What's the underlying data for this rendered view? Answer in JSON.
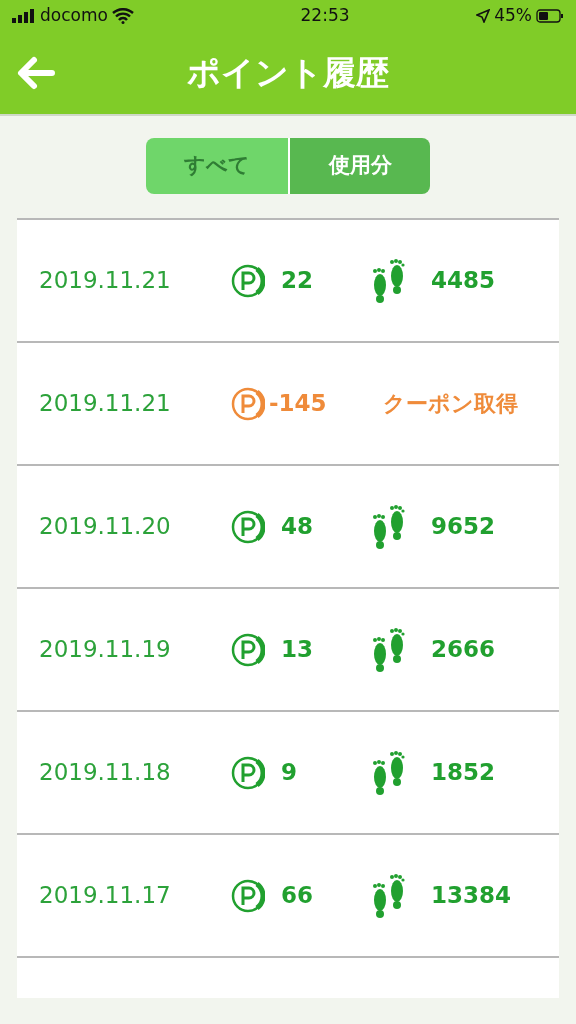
{
  "status_bar": {
    "carrier": "docomo",
    "time": "22:53",
    "battery": "45%"
  },
  "header": {
    "title": "ポイント履歴"
  },
  "tabs": [
    {
      "label": "すべて",
      "selected": false
    },
    {
      "label": "使用分",
      "selected": true
    }
  ],
  "rows": [
    {
      "kind": "steps",
      "date": "2019.11.21",
      "points": "22",
      "steps": "4485"
    },
    {
      "kind": "coupon",
      "date": "2019.11.21",
      "points": "-145",
      "note": "クーポン取得"
    },
    {
      "kind": "steps",
      "date": "2019.11.20",
      "points": "48",
      "steps": "9652"
    },
    {
      "kind": "steps",
      "date": "2019.11.19",
      "points": "13",
      "steps": "2666"
    },
    {
      "kind": "steps",
      "date": "2019.11.18",
      "points": "9",
      "steps": "1852"
    },
    {
      "kind": "steps",
      "date": "2019.11.17",
      "points": "66",
      "steps": "13384"
    }
  ]
}
